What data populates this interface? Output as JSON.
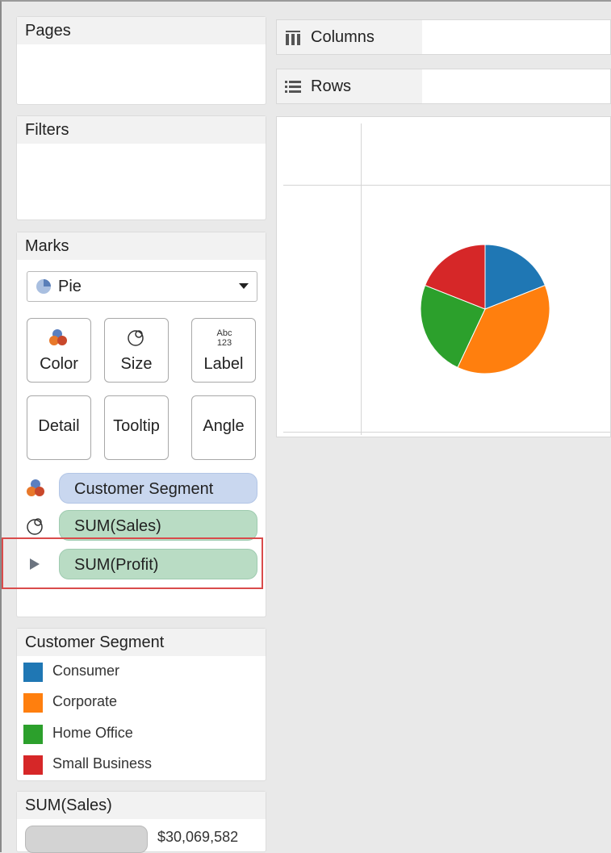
{
  "panels": {
    "pages": {
      "title": "Pages"
    },
    "filters": {
      "title": "Filters"
    },
    "marks": {
      "title": "Marks",
      "mark_type": "Pie",
      "cards": [
        {
          "label": "Color",
          "icon": "color-icon"
        },
        {
          "label": "Size",
          "icon": "size-icon"
        },
        {
          "label": "Label",
          "icon": "label-icon",
          "icon_text_top": "Abc",
          "icon_text_bottom": "123"
        },
        {
          "label": "Detail"
        },
        {
          "label": "Tooltip"
        },
        {
          "label": "Angle"
        }
      ],
      "pills": [
        {
          "label": "Customer Segment",
          "icon": "color-icon",
          "color": "#c9d7ef"
        },
        {
          "label": "SUM(Sales)",
          "icon": "size-icon",
          "color": "#b9dcc4"
        },
        {
          "label": "SUM(Profit)",
          "icon": "angle-icon",
          "color": "#b9dcc4",
          "highlighted": true
        }
      ]
    },
    "legend": {
      "title": "Customer Segment",
      "items": [
        {
          "label": "Consumer",
          "color": "#1f77b4"
        },
        {
          "label": "Corporate",
          "color": "#ff7f0e"
        },
        {
          "label": "Home Office",
          "color": "#2ca02c"
        },
        {
          "label": "Small Business",
          "color": "#d62728"
        }
      ]
    },
    "size_legend": {
      "title": "SUM(Sales)",
      "value": "$30,069,582"
    }
  },
  "shelves": {
    "columns": {
      "label": "Columns"
    },
    "rows": {
      "label": "Rows"
    }
  },
  "chart_data": {
    "type": "pie",
    "categories": [
      "Consumer",
      "Corporate",
      "Home Office",
      "Small Business"
    ],
    "values": [
      19,
      38,
      24,
      19
    ],
    "colors": [
      "#1f77b4",
      "#ff7f0e",
      "#2ca02c",
      "#d62728"
    ]
  }
}
